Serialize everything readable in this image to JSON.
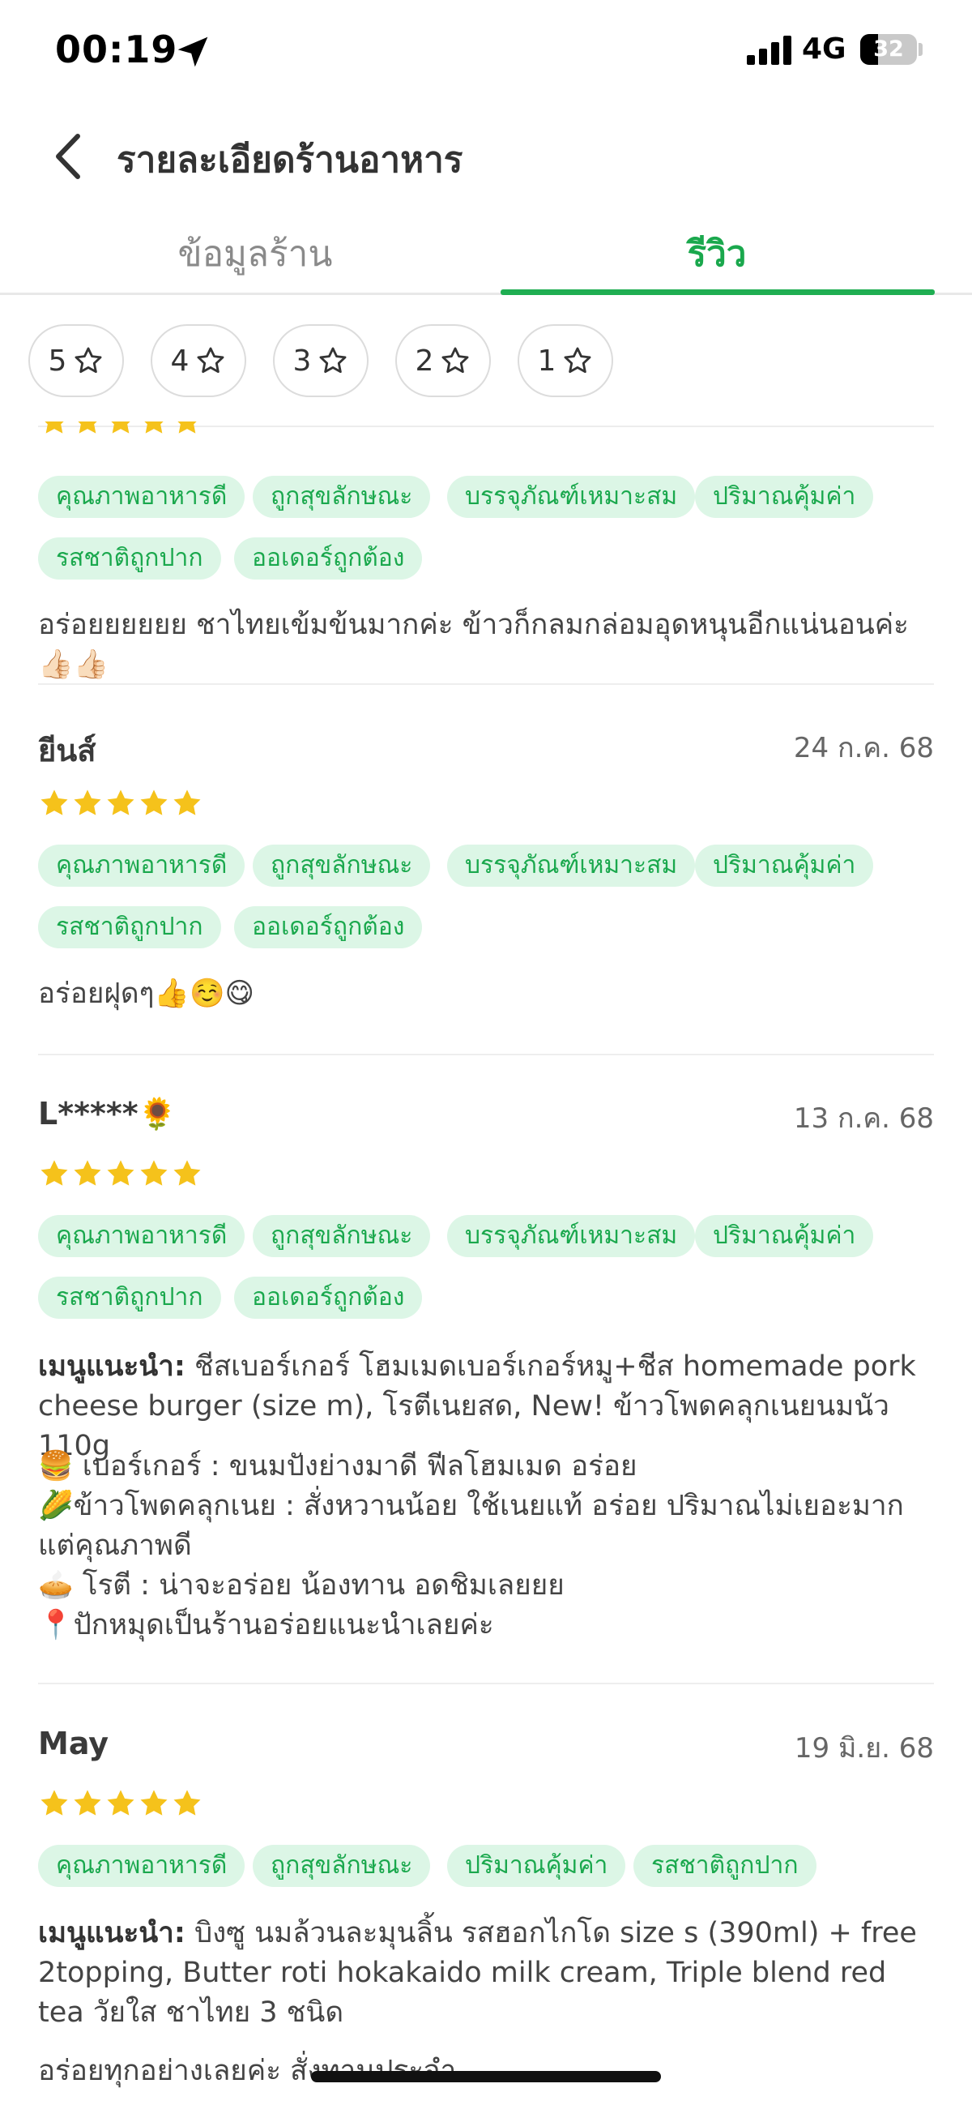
{
  "status_bar": {
    "time": "00:19",
    "network": "4G",
    "battery": "32",
    "battery_level": 0.32
  },
  "header": {
    "title": "รายละเอียดร้านอาหาร"
  },
  "tabs": [
    {
      "label": "ข้อมูลร้าน",
      "active": false
    },
    {
      "label": "รีวิว",
      "active": true
    }
  ],
  "rating_filters": [
    "5",
    "4",
    "3",
    "2",
    "1"
  ],
  "colors": {
    "accent": "#1fae52",
    "tag_bg": "#dcf6e6",
    "star": "#f5c21b"
  },
  "reviews": [
    {
      "name": "",
      "date": "",
      "stars": 5,
      "tags": [
        "คุณภาพอาหารดี",
        "ถูกสุขลักษณะ",
        "บรรจุภัณฑ์เหมาะสม",
        "ปริมาณคุ้มค่า",
        "รสชาติถูกปาก",
        "ออเดอร์ถูกต้อง"
      ],
      "text": "อร่อยยยยยย ชาไทยเข้มข้นมากค่ะ ข้าวก็กลมกล่อมอุดหนุนอีกแน่นอนค่ะ👍🏻👍🏻"
    },
    {
      "name": "ยีนส์",
      "date": "24 ก.ค. 68",
      "stars": 5,
      "tags": [
        "คุณภาพอาหารดี",
        "ถูกสุขลักษณะ",
        "บรรจุภัณฑ์เหมาะสม",
        "ปริมาณคุ้มค่า",
        "รสชาติถูกปาก",
        "ออเดอร์ถูกต้อง"
      ],
      "text": "อร่อยฝุดๆ👍☺️😋"
    },
    {
      "name": "L*****🌻",
      "date": "13 ก.ค. 68",
      "stars": 5,
      "tags": [
        "คุณภาพอาหารดี",
        "ถูกสุขลักษณะ",
        "บรรจุภัณฑ์เหมาะสม",
        "ปริมาณคุ้มค่า",
        "รสชาติถูกปาก",
        "ออเดอร์ถูกต้อง"
      ],
      "menu_label": "เมนูแนะนำ:",
      "menu_text": " ชีสเบอร์เกอร์ โฮมเมดเบอร์เกอร์หมู+ชีส homemade pork cheese burger (size m), โรตีเนยสด, New! ข้าวโพดคลุกเนยนมนัว  110g",
      "text": "🍔 เบอร์เกอร์ : ขนมปังย่างมาดี ฟีลโฮมเมด อร่อย\n🌽ข้าวโพดคลุกเนย : สั่งหวานน้อย ใช้เนยแท้ อร่อย ปริมาณไม่เยอะมาก แต่คุณภาพดี\n🥧 โรตี : น่าจะอร่อย น้องทาน อดชิมเลยยย\n📍ปักหมุดเป็นร้านอร่อยแนะนำเลยค่ะ"
    },
    {
      "name": "May",
      "date": "19 มิ.ย. 68",
      "stars": 5,
      "tags": [
        "คุณภาพอาหารดี",
        "ถูกสุขลักษณะ",
        "ปริมาณคุ้มค่า",
        "รสชาติถูกปาก"
      ],
      "menu_label": "เมนูแนะนำ:",
      "menu_text": " บิงซู นมล้วนละมุนลิ้น รสฮอกไกโด size s (390ml) + free 2topping, Butter roti hokakaido milk cream, Triple blend red tea วัยใส ชาไทย 3 ชนิด",
      "text": "อร่อยทุกอย่างเลยค่ะ สั่งทานประจำ"
    }
  ]
}
